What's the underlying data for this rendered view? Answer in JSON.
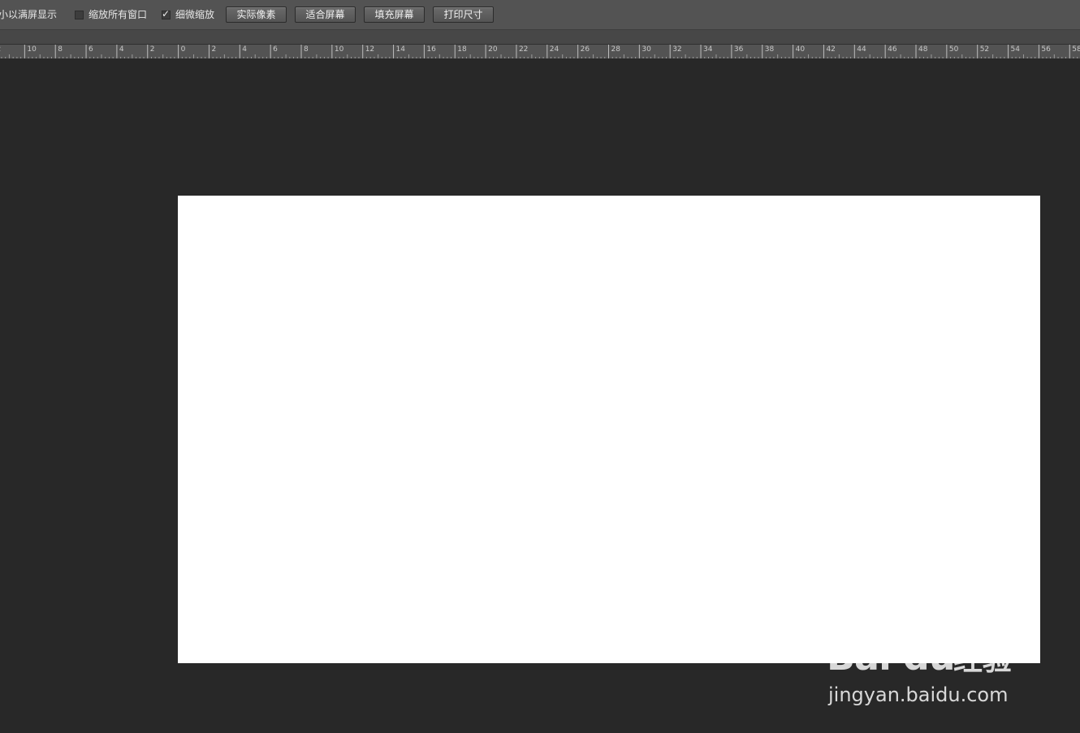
{
  "options_bar": {
    "fit_screen_label": "以满屏显示",
    "fit_screen_prefix": "小",
    "zoom_all_windows": {
      "label": "缩放所有窗口",
      "checked": false
    },
    "scrubby_zoom": {
      "label": "细微缩放",
      "checked": true
    },
    "buttons": {
      "actual_pixels": "实际像素",
      "fit_screen": "适合屏幕",
      "fill_screen": "填充屏幕",
      "print_size": "打印尺寸"
    }
  },
  "ruler": {
    "labels": [
      "2",
      "10",
      "8",
      "6",
      "4",
      "2",
      "0",
      "2",
      "4",
      "6",
      "8",
      "10",
      "12",
      "14",
      "16",
      "18",
      "20",
      "22",
      "24",
      "26",
      "28",
      "30",
      "32",
      "34",
      "36",
      "38",
      "40",
      "42",
      "44",
      "46",
      "48",
      "50",
      "52",
      "54",
      "56",
      "58"
    ]
  },
  "watermark": {
    "logo_text": "Bai du",
    "cn_text": "经验",
    "url": "jingyan.baidu.com"
  },
  "colors": {
    "options_bar_bg": "#535353",
    "workspace_bg": "#282828",
    "document_bg": "#ffffff"
  }
}
